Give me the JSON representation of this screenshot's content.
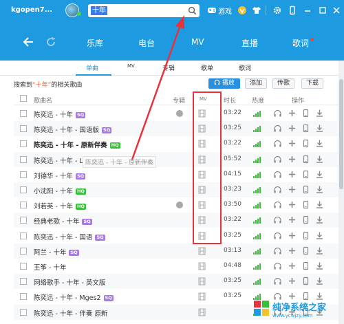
{
  "topbar": {
    "username": "kgopen7...",
    "search_value": "十年",
    "game_label": "游戏"
  },
  "nav": {
    "items": [
      "乐库",
      "电台",
      "MV",
      "直播",
      "歌词"
    ]
  },
  "subtabs": [
    "单曲",
    "MV",
    "专辑",
    "歌单",
    "歌词"
  ],
  "summary": {
    "prefix": "搜索到",
    "keyword": "“十年”",
    "suffix": "的相关歌曲"
  },
  "buttons": {
    "play": "播放",
    "add": "添加",
    "upload": "传歌",
    "download": "下载"
  },
  "headers": {
    "song": "歌曲名",
    "album": "专辑",
    "mv": "MV",
    "duration": "时长",
    "heat": "热度",
    "ops": "操作"
  },
  "tooltip": "陈奕迅 - 十年 - 原新伴奏",
  "rows": [
    {
      "title": "陈奕迅 - 十年",
      "badge": "SQ",
      "bold": false,
      "album": true,
      "mv": true,
      "duration": "03:22"
    },
    {
      "title": "陈奕迅 - 十年 - 国语版",
      "badge": "SQ",
      "bold": false,
      "album": false,
      "mv": true,
      "duration": "03:25"
    },
    {
      "title": "陈奕迅 - 十年 - 原新伴奏",
      "badge": "HQ",
      "bold": true,
      "album": false,
      "mv": true,
      "duration": "03:22"
    },
    {
      "title": "陈奕迅 - 十年 - Live",
      "badge": "",
      "bold": false,
      "album": false,
      "mv": true,
      "duration": "05:52"
    },
    {
      "title": "刘德华 - 十年",
      "badge": "SQ",
      "bold": false,
      "album": false,
      "mv": true,
      "duration": "04:15"
    },
    {
      "title": "小沈阳 - 十年",
      "badge": "HQ",
      "bold": false,
      "album": false,
      "mv": true,
      "duration": "03:23"
    },
    {
      "title": "刘若英 - 十年",
      "badge": "HQ",
      "bold": false,
      "album": true,
      "mv": true,
      "duration": "03:50"
    },
    {
      "title": "经典老歌 - 十年",
      "badge": "SQ",
      "bold": false,
      "album": false,
      "mv": true,
      "duration": "03:22"
    },
    {
      "title": "陈奕迅 - 十年 - 国语",
      "badge": "SQ",
      "bold": false,
      "album": false,
      "mv": true,
      "duration": "03:25"
    },
    {
      "title": "阿兰 - 十年",
      "badge": "SQ",
      "bold": false,
      "album": false,
      "mv": false,
      "duration": "03:13"
    },
    {
      "title": "王筝 - 十年",
      "badge": "",
      "bold": false,
      "album": false,
      "mv": false,
      "duration": "04:48"
    },
    {
      "title": "网络歌手 - 十年 - 英文版",
      "badge": "",
      "bold": false,
      "album": false,
      "mv": false,
      "duration": "03:25"
    },
    {
      "title": "陈奕迅 - 十年 - Mges2",
      "badge": "SQ",
      "bold": false,
      "album": false,
      "mv": false,
      "duration": "03:25"
    },
    {
      "title": "陈奕迅 - 十年 - 伴奏 原新",
      "badge": "",
      "bold": false,
      "album": false,
      "mv": false,
      "duration": ""
    }
  ],
  "watermark": {
    "title": "纯净系统之家",
    "url": "www.ycwjzy.com"
  },
  "colors": {
    "brand": "#1e9be0",
    "annotation": "#e8323b",
    "sq_badge": "#a77ae6",
    "hq_badge": "#36c036"
  }
}
